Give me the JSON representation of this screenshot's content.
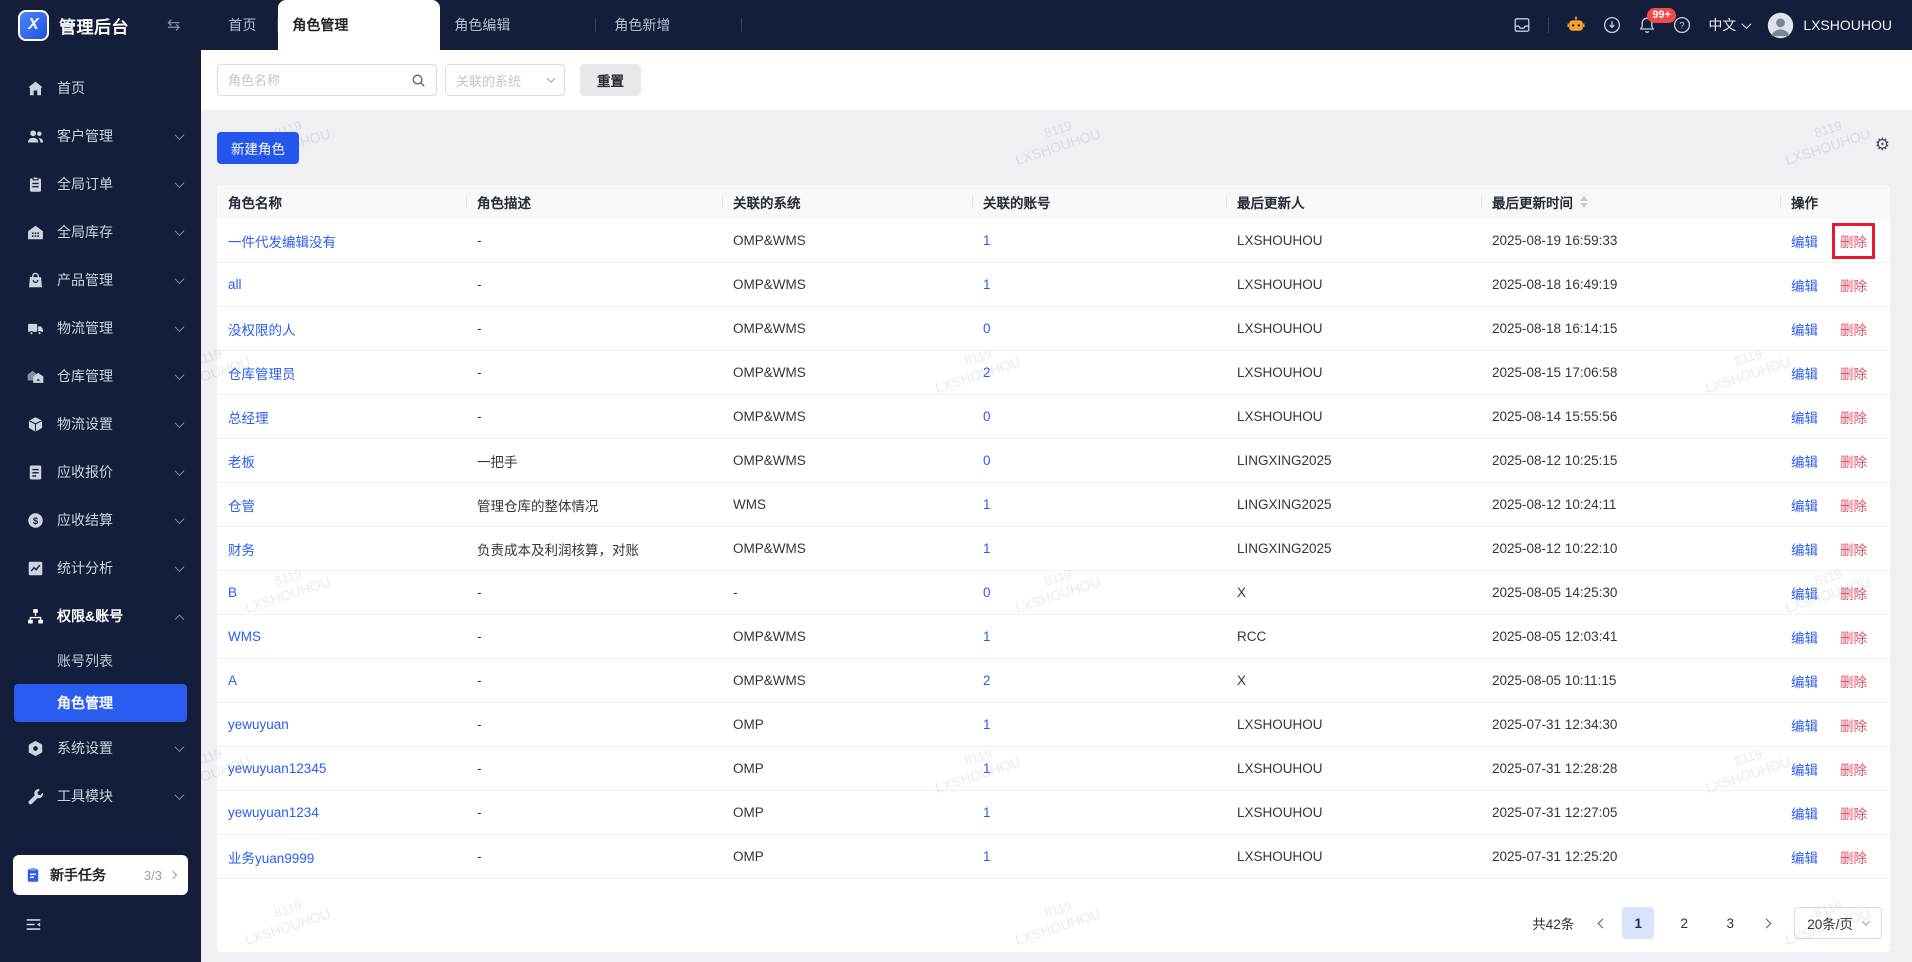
{
  "app": {
    "title": "管理后台",
    "user": "LXSHOUHOU",
    "lang": "中文",
    "notification_badge": "99+"
  },
  "topbar": {
    "tabs": [
      {
        "label": "首页",
        "active": false
      },
      {
        "label": "角色管理",
        "active": true
      },
      {
        "label": "角色编辑",
        "active": false
      },
      {
        "label": "角色新增",
        "active": false
      }
    ],
    "right_icons": [
      "inbox",
      "robot",
      "download",
      "bell",
      "help"
    ]
  },
  "sidebar": {
    "items": [
      {
        "label": "首页",
        "icon": "home",
        "chevron": false
      },
      {
        "label": "客户管理",
        "icon": "users",
        "chevron": true
      },
      {
        "label": "全局订单",
        "icon": "clipboard",
        "chevron": true
      },
      {
        "label": "全局库存",
        "icon": "warehouse",
        "chevron": true
      },
      {
        "label": "产品管理",
        "icon": "bag",
        "chevron": true
      },
      {
        "label": "物流管理",
        "icon": "truck",
        "chevron": true
      },
      {
        "label": "仓库管理",
        "icon": "houses",
        "chevron": true
      },
      {
        "label": "物流设置",
        "icon": "box",
        "chevron": true
      },
      {
        "label": "应收报价",
        "icon": "doc",
        "chevron": true
      },
      {
        "label": "应收结算",
        "icon": "dollar",
        "chevron": true
      },
      {
        "label": "统计分析",
        "icon": "chart",
        "chevron": true
      },
      {
        "label": "权限&账号",
        "icon": "sitemap",
        "chevron": true,
        "expanded": true
      }
    ],
    "sub_items": [
      {
        "label": "账号列表",
        "active": false
      },
      {
        "label": "角色管理",
        "active": true
      }
    ],
    "items_after": [
      {
        "label": "系统设置",
        "icon": "hexnut",
        "chevron": true
      },
      {
        "label": "工具模块",
        "icon": "wrench",
        "chevron": true
      }
    ],
    "newbie": {
      "label": "新手任务",
      "progress": "3/3"
    }
  },
  "filters": {
    "name_placeholder": "角色名称",
    "system_placeholder": "关联的系统",
    "reset_label": "重置",
    "create_label": "新建角色"
  },
  "table": {
    "columns": [
      {
        "label": "角色名称"
      },
      {
        "label": "角色描述"
      },
      {
        "label": "关联的系统"
      },
      {
        "label": "关联的账号"
      },
      {
        "label": "最后更新人"
      },
      {
        "label": "最后更新时间",
        "sortable": true
      },
      {
        "label": "操作"
      }
    ],
    "actions": {
      "edit": "编辑",
      "delete": "删除"
    },
    "rows": [
      {
        "name": "一件代发编辑没有",
        "desc": "-",
        "system": "OMP&WMS",
        "accounts": "1",
        "updater": "LXSHOUHOU",
        "time": "2025-08-19 16:59:33",
        "highlight_delete": true
      },
      {
        "name": "all",
        "desc": "-",
        "system": "OMP&WMS",
        "accounts": "1",
        "updater": "LXSHOUHOU",
        "time": "2025-08-18 16:49:19"
      },
      {
        "name": "没权限的人",
        "desc": "-",
        "system": "OMP&WMS",
        "accounts": "0",
        "updater": "LXSHOUHOU",
        "time": "2025-08-18 16:14:15"
      },
      {
        "name": "仓库管理员",
        "desc": "-",
        "system": "OMP&WMS",
        "accounts": "2",
        "updater": "LXSHOUHOU",
        "time": "2025-08-15 17:06:58"
      },
      {
        "name": "总经理",
        "desc": "-",
        "system": "OMP&WMS",
        "accounts": "0",
        "updater": "LXSHOUHOU",
        "time": "2025-08-14 15:55:56"
      },
      {
        "name": "老板",
        "desc": "一把手",
        "system": "OMP&WMS",
        "accounts": "0",
        "updater": "LINGXING2025",
        "time": "2025-08-12 10:25:15"
      },
      {
        "name": "仓管",
        "desc": "管理仓库的整体情况",
        "system": "WMS",
        "accounts": "1",
        "updater": "LINGXING2025",
        "time": "2025-08-12 10:24:11"
      },
      {
        "name": "财务",
        "desc": "负责成本及利润核算，对账",
        "system": "OMP&WMS",
        "accounts": "1",
        "updater": "LINGXING2025",
        "time": "2025-08-12 10:22:10"
      },
      {
        "name": "B",
        "desc": "-",
        "system": "-",
        "accounts": "0",
        "updater": "X",
        "time": "2025-08-05 14:25:30"
      },
      {
        "name": "WMS",
        "desc": "-",
        "system": "OMP&WMS",
        "accounts": "1",
        "updater": "RCC",
        "time": "2025-08-05 12:03:41"
      },
      {
        "name": "A",
        "desc": "-",
        "system": "OMP&WMS",
        "accounts": "2",
        "updater": "X",
        "time": "2025-08-05 10:11:15"
      },
      {
        "name": "yewuyuan",
        "desc": "-",
        "system": "OMP",
        "accounts": "1",
        "updater": "LXSHOUHOU",
        "time": "2025-07-31 12:34:30"
      },
      {
        "name": "yewuyuan12345",
        "desc": "-",
        "system": "OMP",
        "accounts": "1",
        "updater": "LXSHOUHOU",
        "time": "2025-07-31 12:28:28"
      },
      {
        "name": "yewuyuan1234",
        "desc": "-",
        "system": "OMP",
        "accounts": "1",
        "updater": "LXSHOUHOU",
        "time": "2025-07-31 12:27:05"
      },
      {
        "name": "业务yuan9999",
        "desc": "-",
        "system": "OMP",
        "accounts": "1",
        "updater": "LXSHOUHOU",
        "time": "2025-07-31 12:25:20"
      }
    ]
  },
  "pagination": {
    "total": "共42条",
    "pages": [
      "1",
      "2",
      "3"
    ],
    "current": "1",
    "page_size": "20条/页"
  },
  "watermark": {
    "line1": "8119",
    "line2": "LXSHOUHOU"
  },
  "colors": {
    "navy": "#141e3a",
    "accent": "#2b5cf0",
    "danger_link": "#e25067",
    "highlight_box": "#e8192c",
    "badge": "#f04b4b",
    "robot_orange": "#f6a22d",
    "page_bg": "#eef0f4"
  }
}
